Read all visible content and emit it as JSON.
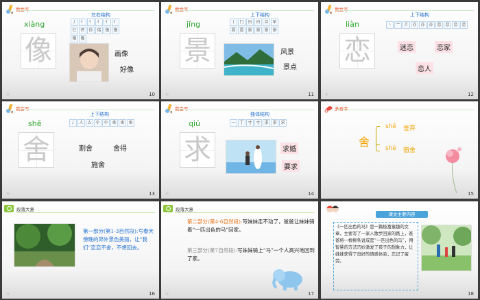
{
  "slides": [
    {
      "num": "10",
      "tag": "我会写",
      "struct": "左右结构",
      "pinyin": "xiàng",
      "char": "像",
      "strokes": [
        "丿",
        "亻",
        "亻",
        "亻",
        "亻",
        "亻",
        "伫",
        "伬",
        "伱",
        "佲",
        "像",
        "像",
        "像",
        "像"
      ],
      "words": [
        "画像",
        "好像"
      ]
    },
    {
      "num": "11",
      "tag": "我会写",
      "struct": "上下结构",
      "pinyin": "jǐng",
      "char": "景",
      "strokes": [
        "丨",
        "冂",
        "日",
        "日",
        "旦",
        "早",
        "昌",
        "昙",
        "景",
        "景",
        "景",
        "景"
      ],
      "words": [
        "风景",
        "景点"
      ]
    },
    {
      "num": "12",
      "tag": "我会写",
      "struct": "上下结构",
      "pinyin": "liàn",
      "char": "恋",
      "strokes": [
        "丶",
        "亠",
        "亣",
        "亦",
        "亦",
        "亦",
        "恋",
        "恋",
        "恋",
        "恋"
      ],
      "words": [
        "迷恋",
        "恋家",
        "恋人"
      ]
    },
    {
      "num": "13",
      "tag": "我会写",
      "struct": "上下结构",
      "pinyin": "shě",
      "char": "舍",
      "strokes": [
        "丿",
        "人",
        "亼",
        "仐",
        "仐",
        "舍",
        "舍",
        "舍"
      ],
      "words": [
        "割舍",
        "舍得",
        "施舍"
      ]
    },
    {
      "num": "14",
      "tag": "我会写",
      "struct": "独体结构",
      "pinyin": "qiú",
      "char": "求",
      "strokes": [
        "一",
        "丁",
        "寸",
        "寸",
        "求",
        "求",
        "求"
      ],
      "words": [
        "求婚",
        "要求"
      ]
    },
    {
      "num": "15",
      "tag": "多音字",
      "char": "舍",
      "readings": [
        {
          "pinyin": "shě",
          "word": "舍弃"
        },
        {
          "pinyin": "shè",
          "word": "宿舍"
        }
      ]
    },
    {
      "num": "16",
      "tag": "段落大意",
      "head": "第一部分(第1-3自然段):",
      "body": "写春天傍晚的郊外景色美丽，让“我们”恋恋不舍，不想回去。"
    },
    {
      "num": "17",
      "tag": "段落大意",
      "p1head": "第二部分(第4-6自然段):",
      "p1body": "写妹妹走不动了，爸爸让妹妹骑着“一匹出色的马”回家。",
      "p2head": "第三部分(第7自然段):",
      "p2body": "写妹妹骑上“马”一个人高兴地回到了家。"
    },
    {
      "num": "18",
      "title": "课文主要内容",
      "body": "《一匹出色的马》是一篇极富童趣的文章，主要写了一家人散步回家的路上，爸爸将一根柳条说成是“一匹出色的马”，用智慧的方法巧妙激发了孩子的想象力，让妹妹获得了良好的情感体验，忘记了疲劳。"
    }
  ],
  "colors": {
    "tag": "#e84a1a",
    "struct": "#1f6fd0",
    "pinyin": "#2aa52a",
    "pink": "#fbe1e6"
  }
}
